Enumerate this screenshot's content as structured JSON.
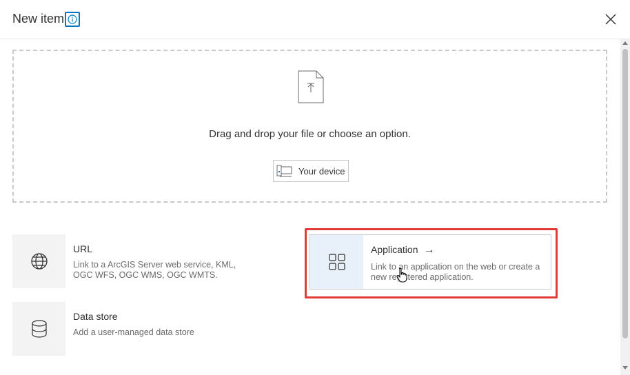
{
  "dialog": {
    "title": "New item",
    "info_icon": "info-icon",
    "close_icon": "close-icon"
  },
  "dropzone": {
    "file_icon": "upload-file-icon",
    "instruction": "Drag and drop your file or choose an option.",
    "device_button": {
      "icon": "device-icon",
      "label": "Your device"
    }
  },
  "options": [
    {
      "id": "url",
      "icon": "globe-icon",
      "title": "URL",
      "description_line1": "Link to a ArcGIS Server web service, KML,",
      "description_line2": "OGC WFS, OGC WMS, OGC WMTS."
    },
    {
      "id": "application",
      "icon": "grid-icon",
      "title": "Application",
      "arrow": "→",
      "description_line1": "Link to an application on the web or create a",
      "description_line2": "new registered application."
    },
    {
      "id": "data-store",
      "icon": "database-icon",
      "title": "Data store",
      "description_line1": "Add a user-managed data store",
      "description_line2": ""
    }
  ],
  "colors": {
    "accent": "#0079c1",
    "highlight": "#e03a3a",
    "selected_icon_bg": "#e8f1fa"
  }
}
